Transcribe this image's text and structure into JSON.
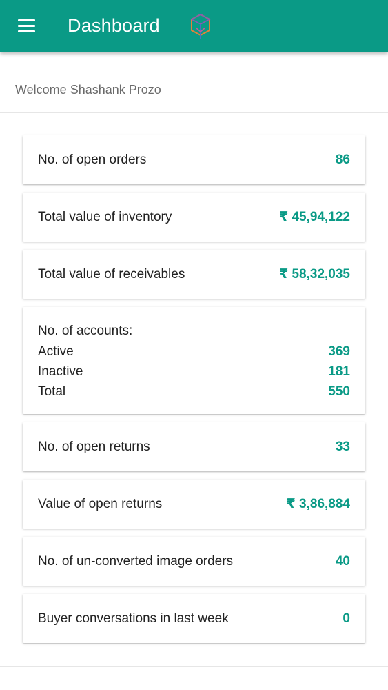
{
  "header": {
    "title": "Dashboard",
    "menu_icon": "hamburger-menu-icon",
    "logo_icon": "brand-logo-icon",
    "color": "#0a9a86"
  },
  "welcome": "Welcome Shashank Prozo",
  "accent_color": "#0a9a86",
  "cards": {
    "open_orders": {
      "label": "No. of open orders",
      "value": "86"
    },
    "inventory_value": {
      "label": "Total value of inventory",
      "value": "₹ 45,94,122"
    },
    "receivables_value": {
      "label": "Total value of receivables",
      "value": "₹ 58,32,035"
    },
    "accounts": {
      "heading": "No. of accounts:",
      "active_label": "Active",
      "active_value": "369",
      "inactive_label": "Inactive",
      "inactive_value": "181",
      "total_label": "Total",
      "total_value": "550"
    },
    "open_returns": {
      "label": "No. of open returns",
      "value": "33"
    },
    "open_returns_value": {
      "label": "Value of open returns",
      "value": "₹ 3,86,884"
    },
    "unconverted_image_orders": {
      "label": "No. of un-converted image orders",
      "value": "40"
    },
    "buyer_conversations": {
      "label": "Buyer conversations in last week",
      "value": "0"
    }
  }
}
